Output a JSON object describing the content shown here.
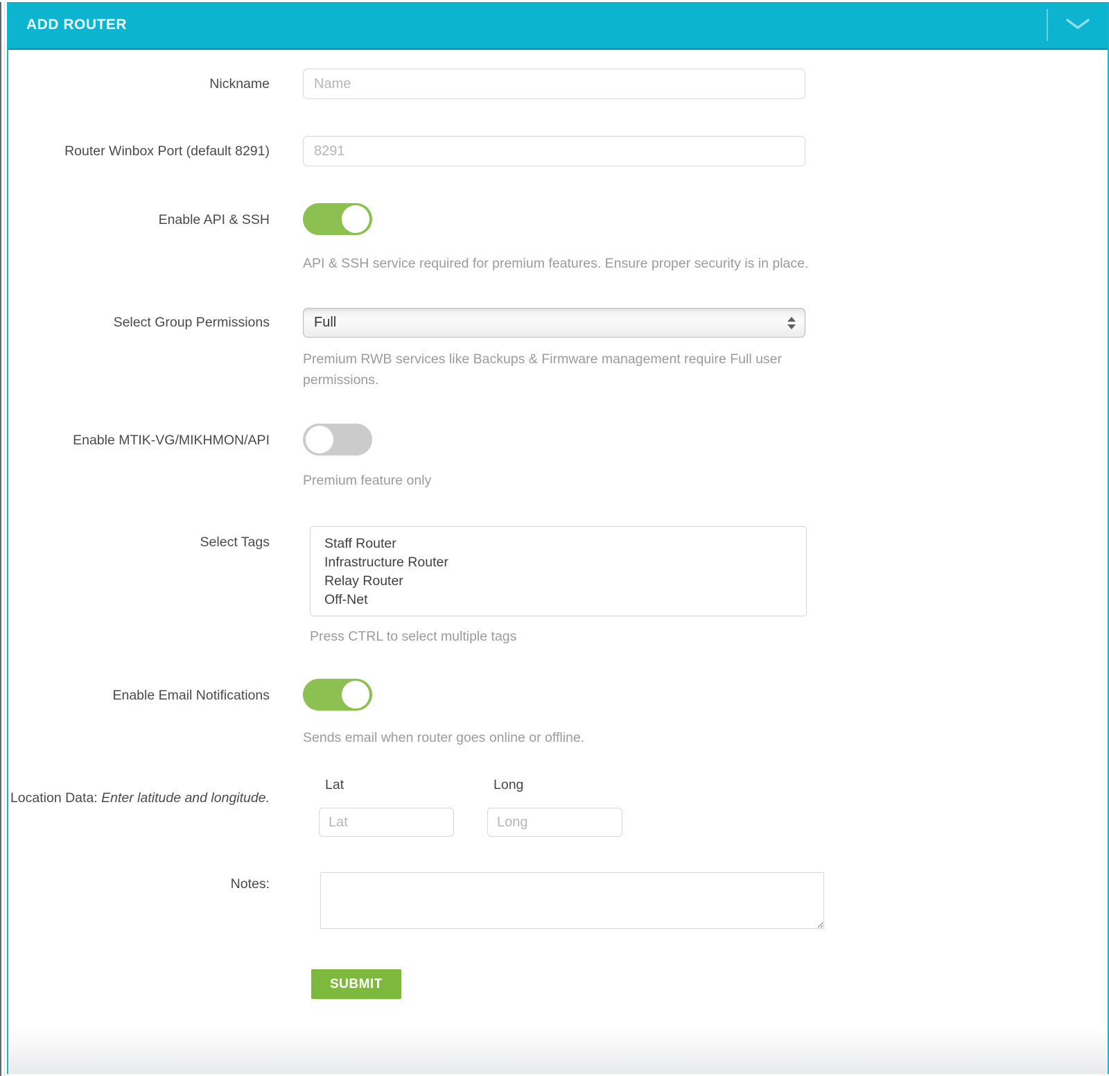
{
  "header": {
    "title": "ADD ROUTER",
    "collapse_icon": "chevron-down-icon"
  },
  "form": {
    "nickname": {
      "label": "Nickname",
      "placeholder": "Name",
      "value": ""
    },
    "winbox_port": {
      "label": "Router Winbox Port (default 8291)",
      "placeholder": "8291",
      "value": ""
    },
    "api_ssh": {
      "label": "Enable API & SSH",
      "state": "on",
      "help": "API & SSH service required for premium features. Ensure proper security is in place."
    },
    "group_permissions": {
      "label": "Select Group Permissions",
      "selected_value": "Full",
      "help": "Premium RWB services like Backups & Firmware management require Full user permissions."
    },
    "mtik": {
      "label": "Enable MTIK-VG/MIKHMON/API",
      "state": "off",
      "help": "Premium feature only"
    },
    "tags": {
      "label": "Select Tags",
      "options": [
        "Staff Router",
        "Infrastructure Router",
        "Relay Router",
        "Off-Net"
      ],
      "help": "Press CTRL to select multiple tags"
    },
    "email_notifications": {
      "label": "Enable Email Notifications",
      "state": "on",
      "help": "Sends email when router goes online or offline."
    },
    "location": {
      "label": "Location Data:",
      "label_note": "Enter latitude and longitude.",
      "lat_label": "Lat",
      "lat_placeholder": "Lat",
      "lat_value": "",
      "long_label": "Long",
      "long_placeholder": "Long",
      "long_value": ""
    },
    "notes": {
      "label": "Notes:",
      "value": ""
    },
    "submit_label": "SUBMIT"
  },
  "colors": {
    "header_bg": "#0db4d0",
    "panel_border": "#16b6d1",
    "toggle_on": "#8cc152",
    "toggle_off": "#cbcbcb",
    "submit_bg": "#7db93c",
    "label_text": "#4a4a4c",
    "help_text": "#9b9b9e"
  }
}
